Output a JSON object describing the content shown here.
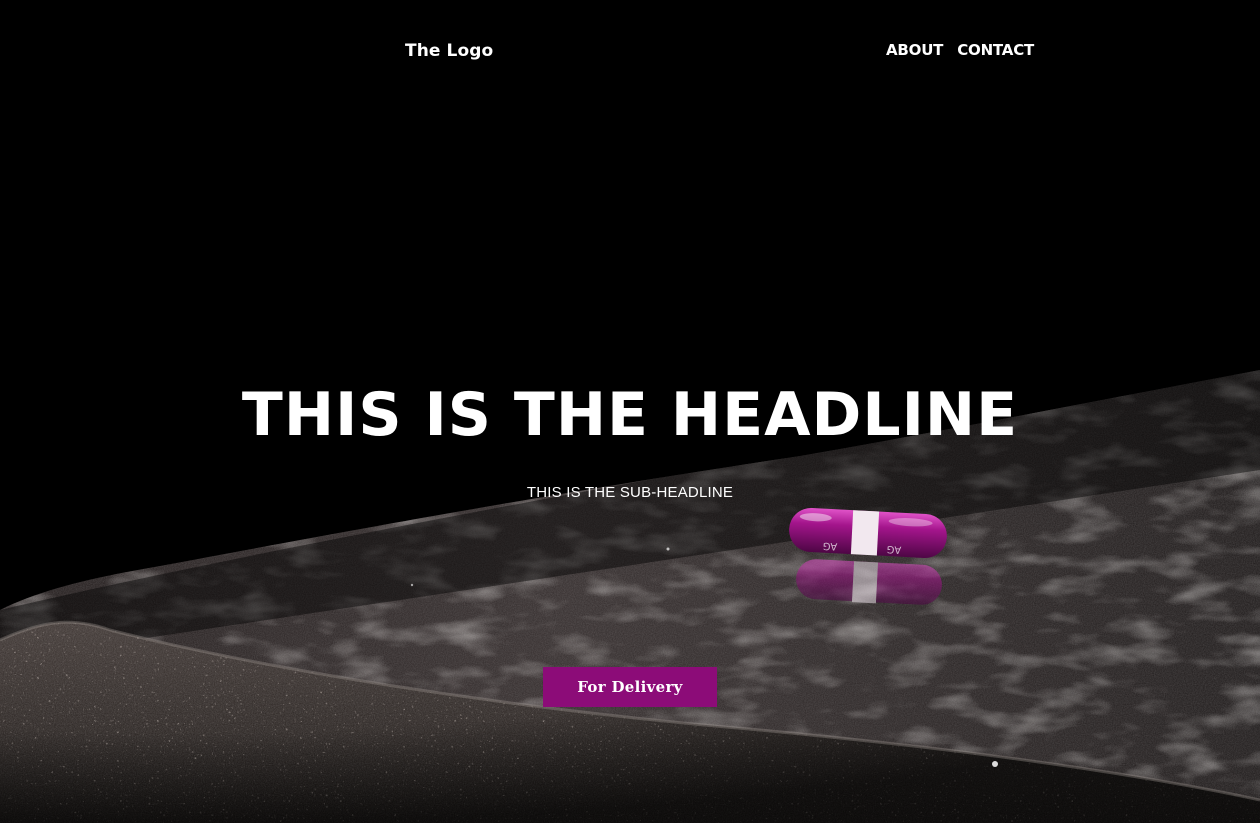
{
  "header": {
    "logo_text": "The Logo",
    "nav": [
      {
        "label": "ABOUT"
      },
      {
        "label": "CONTACT"
      }
    ]
  },
  "hero": {
    "headline": "THIS IS THE HEADLINE",
    "subheadline": "THIS IS THE SUB-HEADLINE",
    "cta_label": "For Delivery",
    "pill_print": "AG",
    "colors": {
      "background": "#000000",
      "accent": "#8c0c78",
      "text": "#ffffff"
    }
  }
}
